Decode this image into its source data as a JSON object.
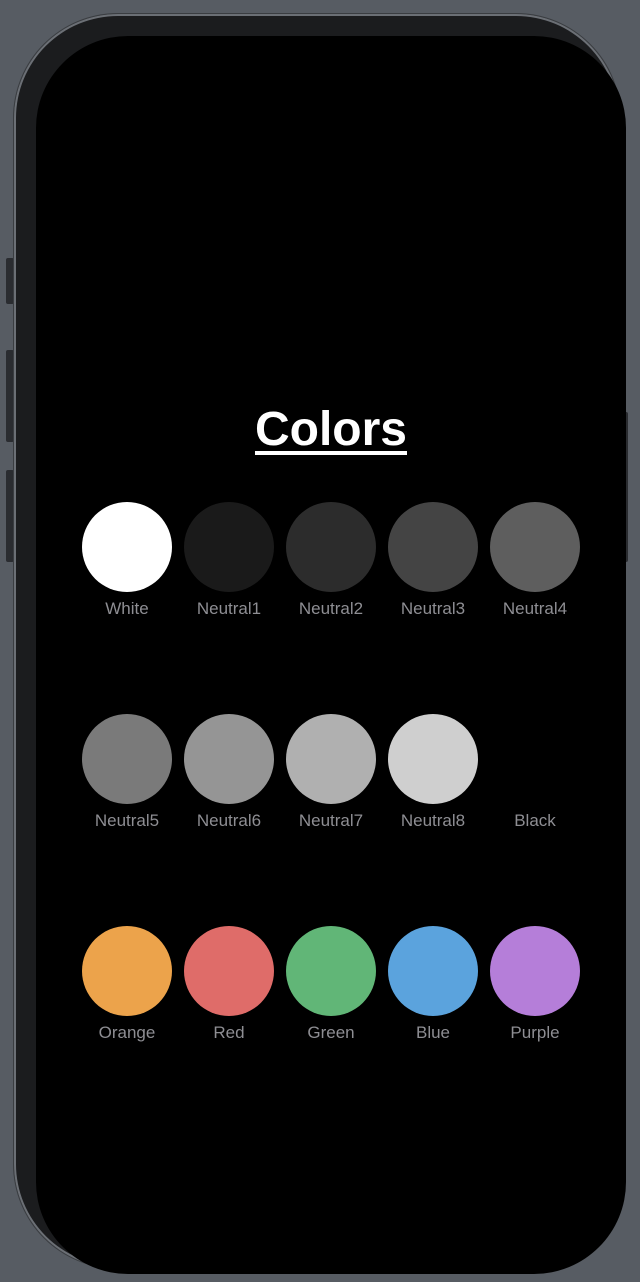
{
  "page": {
    "title": "Colors"
  },
  "swatch_rows": [
    [
      {
        "name": "White",
        "color": "#ffffff"
      },
      {
        "name": "Neutral1",
        "color": "#1a1a1a"
      },
      {
        "name": "Neutral2",
        "color": "#2c2c2c"
      },
      {
        "name": "Neutral3",
        "color": "#444444"
      },
      {
        "name": "Neutral4",
        "color": "#5e5e5e"
      }
    ],
    [
      {
        "name": "Neutral5",
        "color": "#7a7a7a"
      },
      {
        "name": "Neutral6",
        "color": "#959595"
      },
      {
        "name": "Neutral7",
        "color": "#b0b0b0"
      },
      {
        "name": "Neutral8",
        "color": "#cfcfcf"
      },
      {
        "name": "Black",
        "color": "#000000"
      }
    ],
    [
      {
        "name": "Orange",
        "color": "#eca34b"
      },
      {
        "name": "Red",
        "color": "#df6c69"
      },
      {
        "name": "Green",
        "color": "#61b677"
      },
      {
        "name": "Blue",
        "color": "#5ba3dd"
      },
      {
        "name": "Purple",
        "color": "#b57ed9"
      }
    ]
  ]
}
